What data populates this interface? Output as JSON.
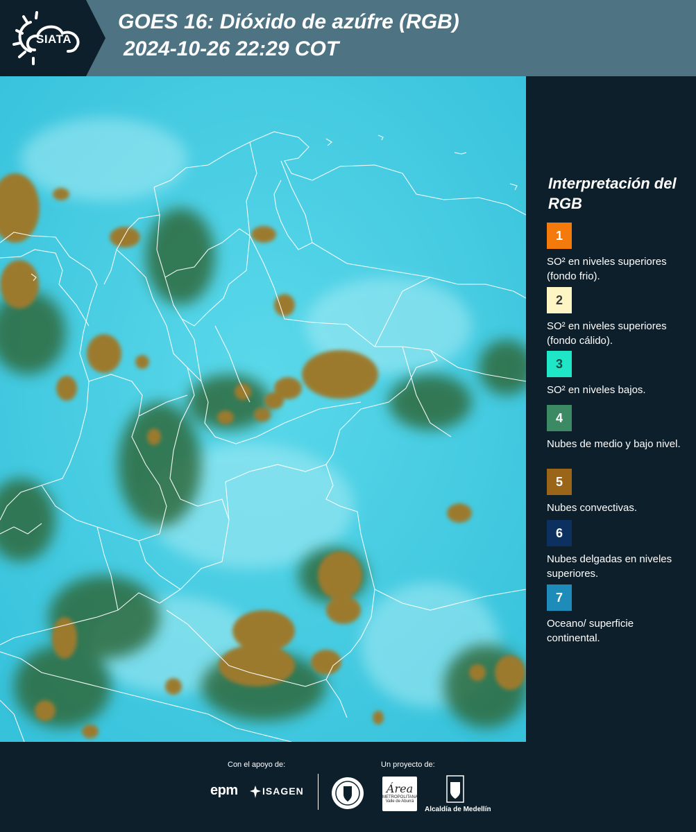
{
  "header": {
    "logo_text": "SIATA",
    "title_line1": "GOES 16: Dióxido de azúfre (RGB)",
    "title_line2": "2024-10-26 22:29 COT"
  },
  "map": {
    "colors": {
      "ocean_surface": "#4dd2e6",
      "convective": "#9b7a2e",
      "mid_low_cloud": "#2e6a3e",
      "borders": "#ffffff"
    }
  },
  "legend": {
    "title": "Interpretación del RGB",
    "items": [
      {
        "number": "1",
        "label": "SO² en niveles superiores (fondo frio).",
        "color": "#f47a0c",
        "text_color": "#ffffff"
      },
      {
        "number": "2",
        "label": "SO² en niveles superiores (fondo cálido).",
        "color": "#fdf5c3",
        "text_color": "#3a3a3a"
      },
      {
        "number": "3",
        "label": "SO² en niveles bajos.",
        "color": "#1ee6c6",
        "text_color": "#1a4a44"
      },
      {
        "number": "4",
        "label": "Nubes de medio y bajo nivel.",
        "color": "#3c8a63",
        "text_color": "#ffffff"
      },
      {
        "number": "5",
        "label": "Nubes convectivas.",
        "color": "#9a6518",
        "text_color": "#ffffff"
      },
      {
        "number": "6",
        "label": "Nubes delgadas en niveles superiores.",
        "color": "#0c3060",
        "text_color": "#ffffff"
      },
      {
        "number": "7",
        "label": "Oceano/ superficie continental.",
        "color": "#1d8cb8",
        "text_color": "#ffffff"
      }
    ]
  },
  "footer": {
    "support_label": "Con el apoyo de:",
    "project_label": "Un proyecto de:",
    "epm": "epm",
    "isagen": "ISAGEN",
    "amva_script": "Área",
    "amva_line1": "METROPOLITANA",
    "amva_line2": "Valle de Aburrá",
    "alcaldia": "Alcaldía de Medellín"
  }
}
